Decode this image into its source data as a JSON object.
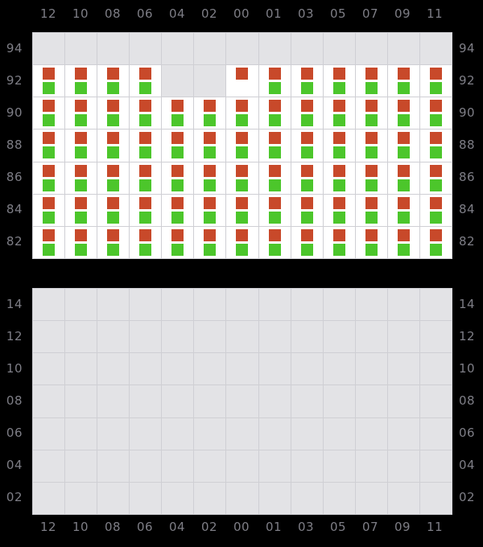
{
  "colors": {
    "background": "#000000",
    "cell_empty": "#e3e3e6",
    "cell_filled": "#ffffff",
    "gridline": "#cfcfd4",
    "marker_up": "#c8492a",
    "marker_down": "#4cc62b",
    "axis_text": "#7e7e86"
  },
  "chart_data": [
    {
      "id": "top",
      "type": "heatmap",
      "title": "",
      "xlabel": "",
      "ylabel": "",
      "grid": true,
      "legend": "none",
      "x_ticks": [
        "12",
        "10",
        "08",
        "06",
        "04",
        "02",
        "00",
        "01",
        "03",
        "05",
        "07",
        "09",
        "11"
      ],
      "y_ticks": [
        "94",
        "92",
        "90",
        "88",
        "86",
        "84",
        "82"
      ],
      "y_ticks_right": [
        "94",
        "92",
        "90",
        "88",
        "86",
        "84",
        "82"
      ],
      "cell_states": [
        [
          "empty",
          "empty",
          "empty",
          "empty",
          "empty",
          "empty",
          "empty",
          "empty",
          "empty",
          "empty",
          "empty",
          "empty",
          "empty"
        ],
        [
          "both",
          "both",
          "both",
          "both",
          "empty",
          "empty",
          "up-only",
          "both",
          "both",
          "both",
          "both",
          "both",
          "both"
        ],
        [
          "both",
          "both",
          "both",
          "both",
          "both",
          "both",
          "both",
          "both",
          "both",
          "both",
          "both",
          "both",
          "both"
        ],
        [
          "both",
          "both",
          "both",
          "both",
          "both",
          "both",
          "both",
          "both",
          "both",
          "both",
          "both",
          "both",
          "both"
        ],
        [
          "both",
          "both",
          "both",
          "both",
          "both",
          "both",
          "both",
          "both",
          "both",
          "both",
          "both",
          "both",
          "both"
        ],
        [
          "both",
          "both",
          "both",
          "both",
          "both",
          "both",
          "both",
          "both",
          "both",
          "both",
          "both",
          "both",
          "both"
        ],
        [
          "both",
          "both",
          "both",
          "both",
          "both",
          "both",
          "both",
          "both",
          "both",
          "both",
          "both",
          "both",
          "both"
        ]
      ]
    },
    {
      "id": "bottom",
      "type": "heatmap",
      "title": "",
      "xlabel": "",
      "ylabel": "",
      "grid": true,
      "legend": "none",
      "x_ticks": [
        "12",
        "10",
        "08",
        "06",
        "04",
        "02",
        "00",
        "01",
        "03",
        "05",
        "07",
        "09",
        "11"
      ],
      "y_ticks": [
        "14",
        "12",
        "10",
        "08",
        "06",
        "04",
        "02"
      ],
      "y_ticks_right": [
        "14",
        "12",
        "10",
        "08",
        "06",
        "04",
        "02"
      ],
      "cell_states": [
        [
          "empty",
          "empty",
          "empty",
          "empty",
          "empty",
          "empty",
          "empty",
          "empty",
          "empty",
          "empty",
          "empty",
          "empty",
          "empty"
        ],
        [
          "empty",
          "empty",
          "empty",
          "empty",
          "empty",
          "empty",
          "empty",
          "empty",
          "empty",
          "empty",
          "empty",
          "empty",
          "empty"
        ],
        [
          "empty",
          "empty",
          "empty",
          "empty",
          "empty",
          "empty",
          "empty",
          "empty",
          "empty",
          "empty",
          "empty",
          "empty",
          "empty"
        ],
        [
          "empty",
          "empty",
          "empty",
          "empty",
          "empty",
          "empty",
          "empty",
          "empty",
          "empty",
          "empty",
          "empty",
          "empty",
          "empty"
        ],
        [
          "empty",
          "empty",
          "empty",
          "empty",
          "empty",
          "empty",
          "empty",
          "empty",
          "empty",
          "empty",
          "empty",
          "empty",
          "empty"
        ],
        [
          "empty",
          "empty",
          "empty",
          "empty",
          "empty",
          "empty",
          "empty",
          "empty",
          "empty",
          "empty",
          "empty",
          "empty",
          "empty"
        ],
        [
          "empty",
          "empty",
          "empty",
          "empty",
          "empty",
          "empty",
          "empty",
          "empty",
          "empty",
          "empty",
          "empty",
          "empty",
          "empty"
        ]
      ]
    }
  ]
}
